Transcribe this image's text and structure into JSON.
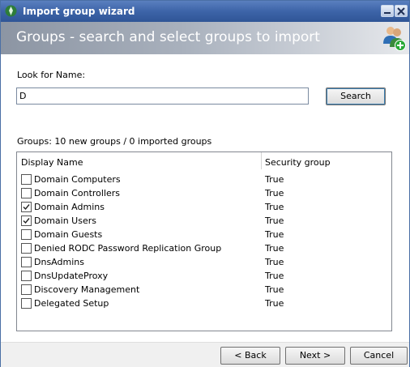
{
  "window": {
    "title": "Import group wizard",
    "header_title": "Groups - search and select groups to import"
  },
  "search": {
    "label": "Look for Name:",
    "value": "D",
    "button_label": "Search"
  },
  "groups": {
    "summary": "Groups: 10 new groups / 0 imported groups",
    "columns": [
      "Display Name",
      "Security group"
    ],
    "rows": [
      {
        "name": "Domain Computers",
        "security": "True",
        "checked": false
      },
      {
        "name": "Domain Controllers",
        "security": "True",
        "checked": false
      },
      {
        "name": "Domain Admins",
        "security": "True",
        "checked": true
      },
      {
        "name": "Domain Users",
        "security": "True",
        "checked": true
      },
      {
        "name": "Domain Guests",
        "security": "True",
        "checked": false
      },
      {
        "name": "Denied RODC Password Replication Group",
        "security": "True",
        "checked": false
      },
      {
        "name": "DnsAdmins",
        "security": "True",
        "checked": false
      },
      {
        "name": "DnsUpdateProxy",
        "security": "True",
        "checked": false
      },
      {
        "name": "Discovery Management",
        "security": "True",
        "checked": false
      },
      {
        "name": "Delegated Setup",
        "security": "True",
        "checked": false
      }
    ]
  },
  "footer": {
    "back_label": "< Back",
    "next_label": "Next >",
    "cancel_label": "Cancel"
  },
  "icons": {
    "app": "app-icon",
    "header": "group-add-icon",
    "minimize": "minimize-icon",
    "close": "close-icon"
  },
  "colors": {
    "titlebar": "#3d64a8",
    "header_gradient_start": "#8c95a3",
    "header_gradient_end": "#e7e9ec",
    "focus_ring": "#3c7fb1"
  }
}
